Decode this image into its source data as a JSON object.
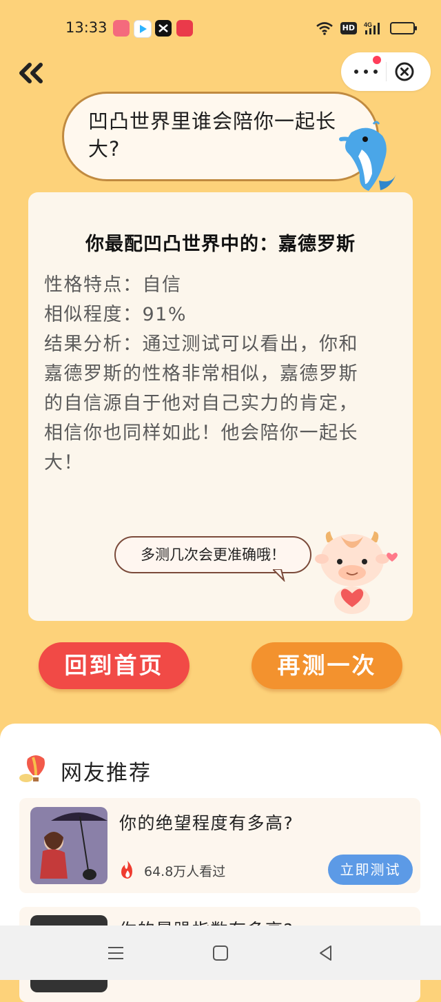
{
  "status_bar": {
    "time": "13:33",
    "app_icons": [
      {
        "name": "app-icon-pink",
        "color": "#f46a7d"
      },
      {
        "name": "app-icon-video",
        "color": "#2bb3ff"
      },
      {
        "name": "app-icon-capcut",
        "color": "#111111"
      },
      {
        "name": "app-icon-red",
        "color": "#ea3a4a"
      }
    ],
    "hd_label": "HD",
    "network": "4G"
  },
  "top_nav": {
    "back_icon": "double-chevron-left-icon",
    "more_icon": "more-dots-icon",
    "close_icon": "close-circle-icon"
  },
  "question": {
    "text": "凹凸世界里谁会陪你一起长大?"
  },
  "result": {
    "title": "你最配凹凸世界中的：嘉德罗斯",
    "lines": [
      "性格特点：自信",
      "相似程度：91%",
      "结果分析：通过测试可以看出，你和",
      "嘉德罗斯的性格非常相似，嘉德罗斯",
      "的自信源自于他对自己实力的肯定，",
      "相信你也同样如此！他会陪你一起长",
      "大！"
    ],
    "tip": "多测几次会更准确哦！"
  },
  "buttons": {
    "home": "回到首页",
    "retry": "再测一次"
  },
  "recommend": {
    "title": "网友推荐",
    "items": [
      {
        "title": "你的绝望程度有多高?",
        "views": "64.8万人看过",
        "action": "立即测试"
      },
      {
        "title": "你的暴躁指数有多高?"
      }
    ]
  },
  "colors": {
    "background": "#fdd27a",
    "home_button": "#f14a46",
    "retry_button": "#f3922e",
    "test_button": "#5c9ae6"
  }
}
